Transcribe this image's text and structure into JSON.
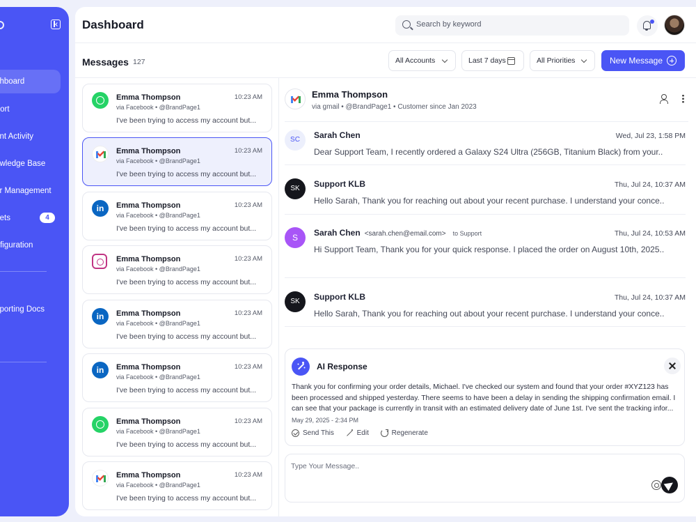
{
  "sidebar": {
    "items": [
      {
        "label": "Dashboard",
        "active": true
      },
      {
        "label": "Report"
      },
      {
        "label": "Agent Activity"
      },
      {
        "label": "Knowledge Base"
      },
      {
        "label": "User Management"
      },
      {
        "label": "Tickets",
        "badge": "4"
      },
      {
        "label": "Configuration"
      },
      {
        "label": "Supporting Docs"
      }
    ]
  },
  "header": {
    "title": "Dashboard",
    "search_placeholder": "Search by keyword"
  },
  "toolbar": {
    "messages_title": "Messages",
    "messages_count": "127",
    "filter_accounts": "All Accounts",
    "filter_period": "Last 7 days",
    "filter_priorities": "All Priorities",
    "new_message_label": "New Message"
  },
  "messages": [
    {
      "channel": "whatsapp",
      "name": "Emma Thompson",
      "time": "10:23 AM",
      "via": "via Facebook • @BrandPage1",
      "preview": "I've been trying to access my account but..."
    },
    {
      "channel": "gmail",
      "name": "Emma Thompson",
      "time": "10:23 AM",
      "via": "via Facebook • @BrandPage1",
      "preview": "I've been trying to access my account but...",
      "selected": true
    },
    {
      "channel": "linkedin",
      "name": "Emma Thompson",
      "time": "10:23 AM",
      "via": "via Facebook • @BrandPage1",
      "preview": "I've been trying to access my account but..."
    },
    {
      "channel": "instagram",
      "name": "Emma Thompson",
      "time": "10:23 AM",
      "via": "via Facebook • @BrandPage1",
      "preview": "I've been trying to access my account but..."
    },
    {
      "channel": "linkedin",
      "name": "Emma Thompson",
      "time": "10:23 AM",
      "via": "via Facebook • @BrandPage1",
      "preview": "I've been trying to access my account but..."
    },
    {
      "channel": "linkedin",
      "name": "Emma Thompson",
      "time": "10:23 AM",
      "via": "via Facebook • @BrandPage1",
      "preview": "I've been trying to access my account but..."
    },
    {
      "channel": "whatsapp",
      "name": "Emma Thompson",
      "time": "10:23 AM",
      "via": "via Facebook • @BrandPage1",
      "preview": "I've been trying to access my account but..."
    },
    {
      "channel": "gmail",
      "name": "Emma Thompson",
      "time": "10:23 AM",
      "via": "via Facebook • @BrandPage1",
      "preview": "I've been trying to access my account but..."
    }
  ],
  "thread": {
    "contact_name": "Emma Thompson",
    "contact_sub": "via gmail • @BrandPage1 • Customer since Jan 2023",
    "entries": [
      {
        "initials": "SC",
        "name": "Sarah Chen",
        "time": "Wed, Jul 23, 1:58 PM",
        "body": "Dear Support Team, I recently ordered a Galaxy S24 Ultra (256GB, Titanium Black) from your.."
      },
      {
        "initials": "SK",
        "name": "Support KLB",
        "time": "Thu, Jul 24, 10:37 AM",
        "body": "Hello Sarah, Thank you for reaching out about your recent purchase. I understand your conce.."
      },
      {
        "initials": "S",
        "name": "Sarah Chen",
        "email": "<sarah.chen@email.com>",
        "to": "to Support",
        "time": "Thu, Jul 24, 10:53 AM",
        "body": "Hi Support Team, Thank you for your quick response. I placed the order on August 10th, 2025.."
      },
      {
        "initials": "SK",
        "name": "Support KLB",
        "time": "Thu, Jul 24, 10:37 AM",
        "body": "Hello Sarah, Thank you for reaching out about your recent purchase. I understand your conce.."
      }
    ]
  },
  "ai_response": {
    "title": "AI Response",
    "lines": [
      "Thank you for confirming your order details, Michael. I've checked our system and found that your order #XYZ123 has",
      "been processed and shipped yesterday. There seems to have been a delay in sending the shipping confirmation email. I",
      "can see that your package is currently in transit with an estimated delivery date of June 1st. I've sent the tracking infor..."
    ],
    "date": "May 29, 2025 - 2:34 PM",
    "send_label": "Send This",
    "edit_label": "Edit",
    "regenerate_label": "Regenerate"
  },
  "composer": {
    "placeholder": "Type Your Message.."
  },
  "colors": {
    "accent": "#4a55f5",
    "sidebar_bg": "#4a55f5",
    "selected_bg": "#eef0fd"
  }
}
